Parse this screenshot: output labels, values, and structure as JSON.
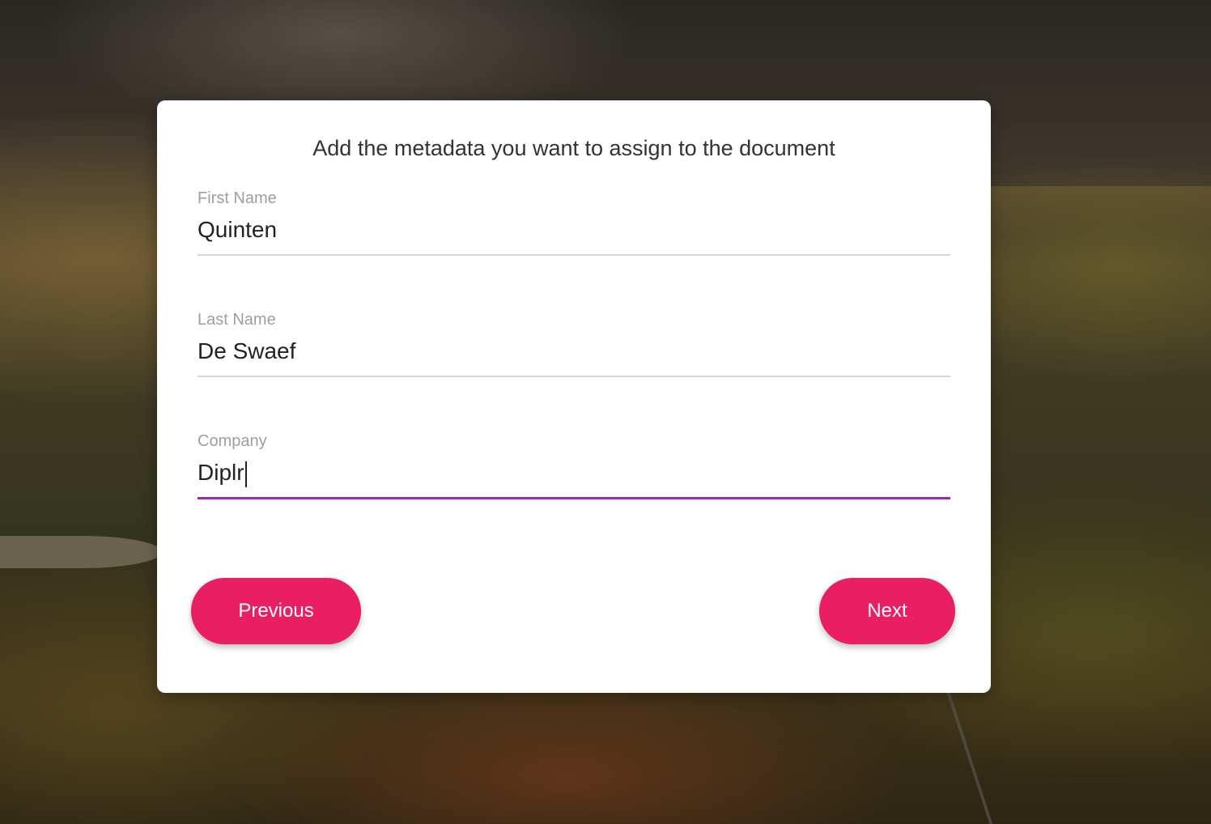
{
  "dialog": {
    "title": "Add the metadata you want to assign to the document"
  },
  "fields": {
    "first_name": {
      "label": "First Name",
      "value": "Quinten"
    },
    "last_name": {
      "label": "Last Name",
      "value": "De Swaef"
    },
    "company": {
      "label": "Company",
      "value": "Diplr",
      "focused": true
    }
  },
  "buttons": {
    "previous_label": "Previous",
    "next_label": "Next"
  },
  "colors": {
    "accent_button": "#e91e63",
    "focus_underline": "#9c27b0",
    "card_background": "#ffffff"
  }
}
